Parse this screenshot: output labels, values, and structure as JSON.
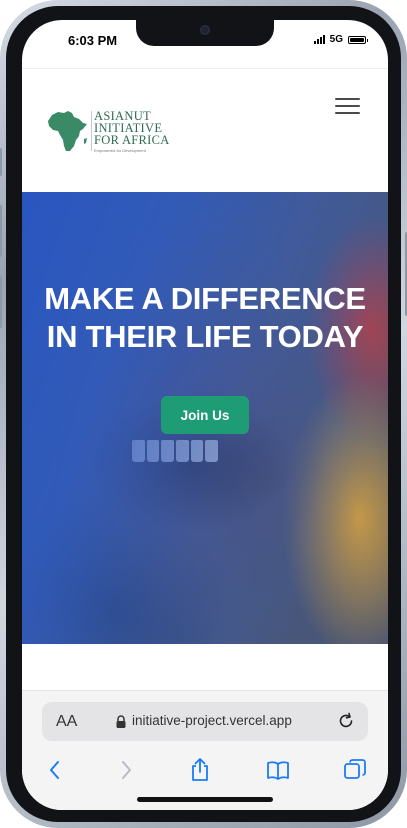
{
  "status": {
    "time": "6:03 PM",
    "network": "5G"
  },
  "header": {
    "logo": {
      "line1": "ASIANUT",
      "line2": "INITIATIVE",
      "line3": "FOR AFRICA",
      "tagline": "Empowered for Development",
      "color": "#2f6b52"
    }
  },
  "hero": {
    "title_line1": "MAKE A DIFFERENCE",
    "title_line2": "IN THEIR LIFE TODAY",
    "button_label": "Join Us",
    "button_color": "#1e9c73",
    "overlay_color": "#2856c4"
  },
  "browser": {
    "text_size_label": "AA",
    "url": "initiative-project.vercel.app",
    "icons": [
      "text-size-icon",
      "lock-icon",
      "reload-icon",
      "back-icon",
      "forward-icon",
      "share-icon",
      "bookmarks-icon",
      "tabs-icon"
    ]
  }
}
